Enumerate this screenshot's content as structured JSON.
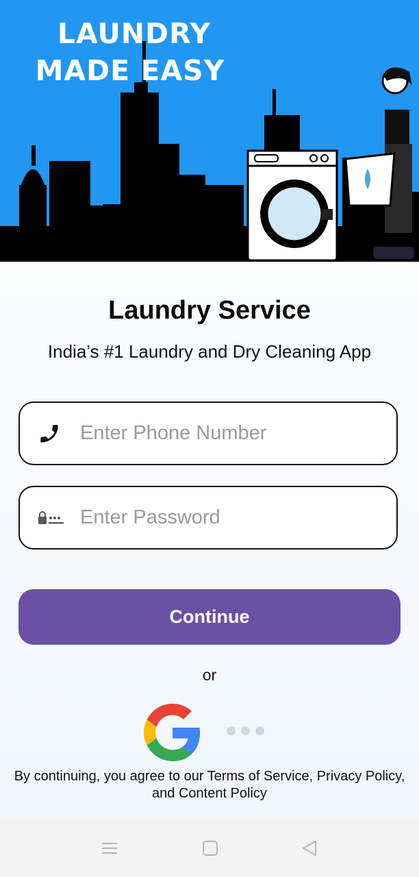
{
  "hero": {
    "title_line1": "LAUNDRY",
    "title_line2": "MADE EASY",
    "colors": {
      "sky": "#2196f3",
      "skyline": "#000000"
    }
  },
  "app": {
    "title": "Laundry Service",
    "subtitle": "India’s #1 Laundry and Dry Cleaning App"
  },
  "form": {
    "phone": {
      "placeholder": "Enter Phone Number",
      "value": "",
      "icon": "phone-icon"
    },
    "password": {
      "placeholder": "Enter Password",
      "value": "",
      "icon": "lock-password-icon"
    },
    "continue_label": "Continue"
  },
  "divider_text": "or",
  "social": {
    "google": "google-icon",
    "more": "more-options-icon"
  },
  "terms": {
    "line1": "By continuing, you agree to our Terms of Service, Privacy Policy,",
    "line2": "and Content Policy"
  },
  "navbar": {
    "menu": "menu-icon",
    "home": "home-square-icon",
    "back": "back-triangle-icon"
  },
  "colors": {
    "primary": "#6a51a5",
    "background": "#f5f9fd"
  }
}
